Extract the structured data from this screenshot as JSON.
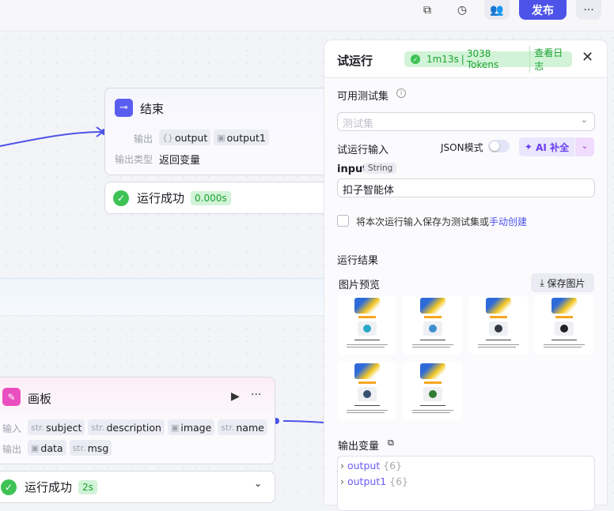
{
  "topbar": {
    "publish_label": "发布"
  },
  "end_node": {
    "title": "结束",
    "output_label": "输出",
    "outputs": [
      "output",
      "output1"
    ],
    "output_type_label": "输出类型",
    "output_type": "返回变量",
    "status": "运行成功",
    "duration": "0.000s"
  },
  "canvas_node": {
    "title": "画板",
    "input_label": "输入",
    "inputs": [
      {
        "type": "str.",
        "name": "subject"
      },
      {
        "type": "str.",
        "name": "description"
      },
      {
        "type": "img",
        "name": "image"
      },
      {
        "type": "str.",
        "name": "name"
      }
    ],
    "output_label": "输出",
    "outputs": [
      {
        "type": "img",
        "name": "data"
      },
      {
        "type": "str.",
        "name": "msg"
      }
    ],
    "status": "运行成功",
    "duration": "2s"
  },
  "panel": {
    "title": "试运行",
    "run_time": "1m13s",
    "tokens": "3038 Tokens",
    "view_log": "查看日志",
    "testset_label": "可用测试集",
    "testset_placeholder": "测试集",
    "run_input_label": "试运行输入",
    "json_mode_label": "JSON模式",
    "json_mode_on": false,
    "ai_fill_label": "AI 补全",
    "input_name": "input",
    "input_type": "String",
    "input_value": "扣子智能体",
    "save_text": "将本次运行输入保存为测试集或",
    "manual_create": "手动创建",
    "result_label": "运行结果",
    "image_preview_label": "图片预览",
    "save_image_label": "保存图片",
    "image_count": 6,
    "output_vars_label": "输出变量",
    "output_vars": [
      {
        "name": "output",
        "count": "{6}"
      },
      {
        "name": "output1",
        "count": "{6}"
      }
    ]
  },
  "colors": {
    "accent": "#4d53e8",
    "success": "#3ec254",
    "thumb_faces": [
      "#2aa9c9",
      "#3d8fd0",
      "#333842",
      "#222",
      "#3a5070",
      "#2e7d32"
    ]
  }
}
